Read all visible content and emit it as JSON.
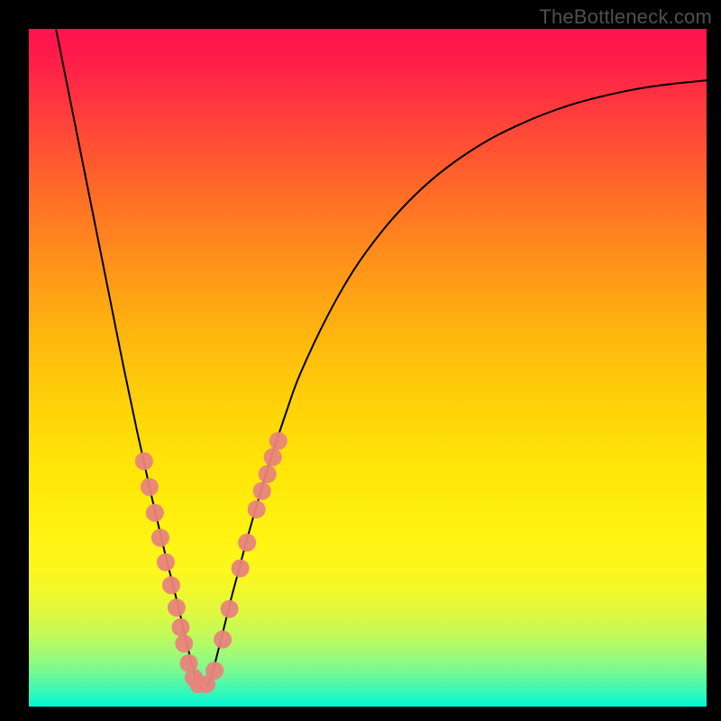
{
  "watermark": {
    "text": "TheBottleneck.com"
  },
  "colors": {
    "frame": "#000000",
    "curve": "#000000",
    "dot": "#e8847c",
    "gradient_top": "#ff134e",
    "gradient_bottom": "#00f7d4"
  },
  "chart_data": {
    "type": "line",
    "title": "",
    "xlabel": "",
    "ylabel": "",
    "xlim": [
      0,
      100
    ],
    "ylim": [
      0,
      100
    ],
    "grid": false,
    "legend": "none",
    "note": "Axes unlabeled; values are estimated from pixel positions on a 0–100 normalized scale. Curve is a V-shaped bottleneck profile with minimum near x≈25.",
    "series": [
      {
        "name": "bottleneck-curve",
        "x": [
          4,
          6,
          8,
          10,
          12,
          14,
          16,
          18,
          20,
          22,
          23.5,
          25,
          26.5,
          28,
          30,
          32,
          34,
          36,
          38,
          40,
          44,
          48,
          52,
          56,
          60,
          64,
          68,
          72,
          76,
          80,
          84,
          88,
          92,
          96,
          100
        ],
        "y": [
          100,
          90,
          80,
          70,
          60,
          50,
          40.5,
          31.5,
          23,
          15,
          8.5,
          3.3,
          3.3,
          8.5,
          16.5,
          24,
          31,
          37.5,
          43.5,
          49,
          57.5,
          64.5,
          70,
          74.5,
          78.2,
          81.2,
          83.7,
          85.7,
          87.4,
          88.8,
          89.9,
          90.8,
          91.5,
          92,
          92.4
        ]
      }
    ],
    "scatter": [
      {
        "name": "highlight-dots",
        "radius": 10,
        "points": [
          {
            "x": 17.0,
            "y": 36.2
          },
          {
            "x": 17.8,
            "y": 32.4
          },
          {
            "x": 18.6,
            "y": 28.6
          },
          {
            "x": 19.4,
            "y": 24.9
          },
          {
            "x": 20.2,
            "y": 21.3
          },
          {
            "x": 21.0,
            "y": 17.9
          },
          {
            "x": 21.8,
            "y": 14.6
          },
          {
            "x": 22.4,
            "y": 11.7
          },
          {
            "x": 22.9,
            "y": 9.3
          },
          {
            "x": 23.6,
            "y": 6.4
          },
          {
            "x": 24.3,
            "y": 4.3
          },
          {
            "x": 25.0,
            "y": 3.3
          },
          {
            "x": 26.2,
            "y": 3.3
          },
          {
            "x": 27.4,
            "y": 5.3
          },
          {
            "x": 28.6,
            "y": 9.9
          },
          {
            "x": 29.6,
            "y": 14.4
          },
          {
            "x": 31.2,
            "y": 20.4
          },
          {
            "x": 32.2,
            "y": 24.2
          },
          {
            "x": 33.6,
            "y": 29.1
          },
          {
            "x": 34.4,
            "y": 31.8
          },
          {
            "x": 35.2,
            "y": 34.3
          },
          {
            "x": 36.0,
            "y": 36.8
          },
          {
            "x": 36.8,
            "y": 39.2
          }
        ]
      }
    ]
  }
}
